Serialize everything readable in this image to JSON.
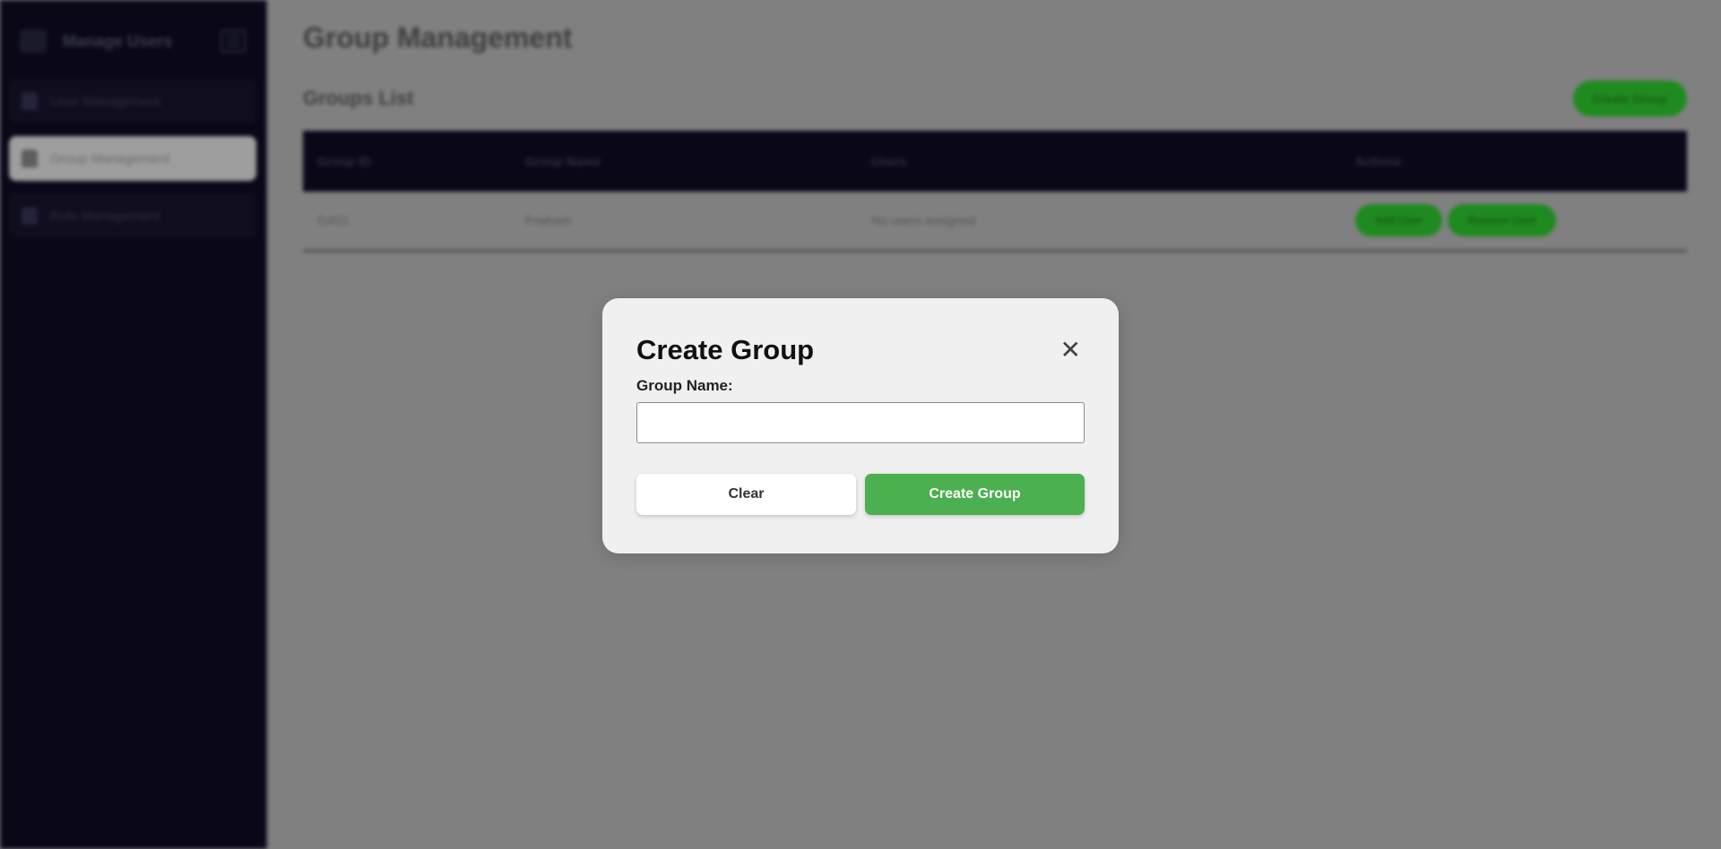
{
  "sidebar": {
    "brand_title": "Manage Users",
    "items": [
      {
        "label": "User Management",
        "active": false
      },
      {
        "label": "Group Management",
        "active": true
      },
      {
        "label": "Role Management",
        "active": false
      }
    ]
  },
  "main": {
    "page_title": "Group Management",
    "list_title": "Groups List",
    "create_button": "Create Group",
    "table": {
      "headers": [
        "Group ID",
        "Group Name",
        "Users",
        "Actions"
      ],
      "rows": [
        {
          "id": "G4S1",
          "name": "Fraiham",
          "users": "No users assigned",
          "actions": [
            "Add User",
            "Remove User"
          ]
        }
      ]
    }
  },
  "modal": {
    "title": "Create Group",
    "close_glyph": "✕",
    "field_label": "Group Name:",
    "field_value": "",
    "clear_label": "Clear",
    "submit_label": "Create Group"
  },
  "colors": {
    "sidebar_bg": "#0a0818",
    "overlay_bg": "#808080",
    "modal_bg": "#f0f0f0",
    "accent_green": "#4caf50"
  }
}
